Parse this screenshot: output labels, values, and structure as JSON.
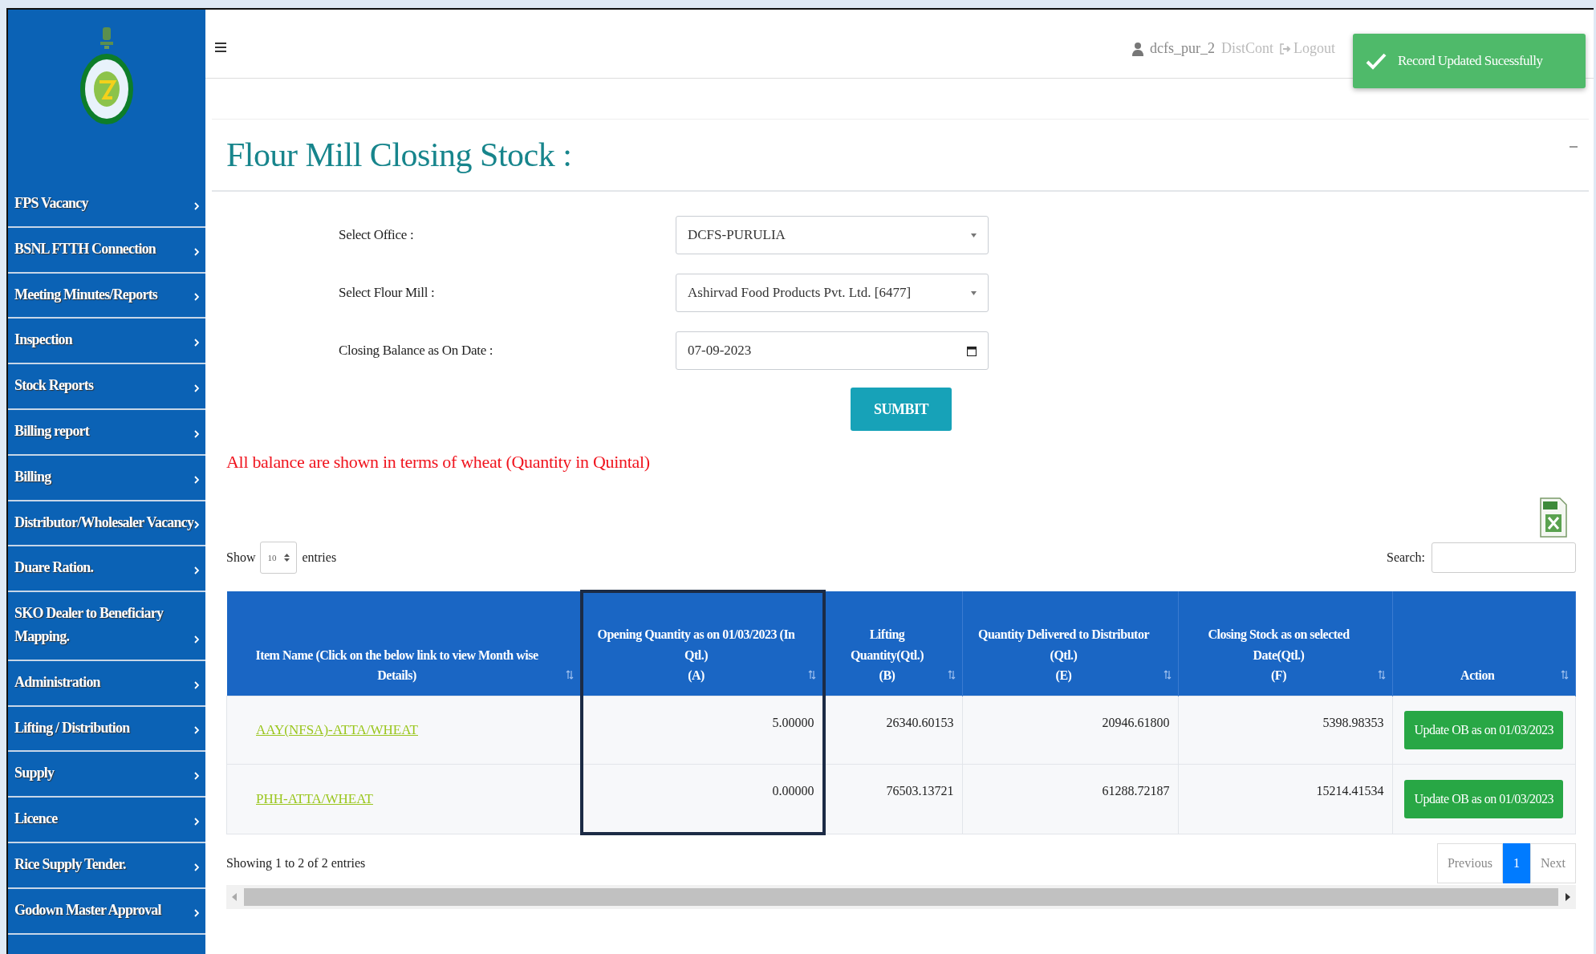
{
  "sidebar": {
    "items": [
      {
        "label": "FPS Vacancy",
        "selected": false
      },
      {
        "label": "BSNL FTTH Connection",
        "selected": false
      },
      {
        "label": "Meeting Minutes/Reports",
        "selected": false
      },
      {
        "label": "Inspection",
        "selected": false
      },
      {
        "label": "Stock Reports",
        "selected": false
      },
      {
        "label": "Billing report",
        "selected": false
      },
      {
        "label": "Billing",
        "selected": false
      },
      {
        "label": "Distributor/Wholesaler Vacancy",
        "selected": false
      },
      {
        "label": "Duare Ration.",
        "selected": false
      },
      {
        "label": "SKO Dealer to Beneficiary Mapping.",
        "selected": false
      },
      {
        "label": "Administration",
        "selected": false
      },
      {
        "label": "Lifting / Distribution",
        "selected": false
      },
      {
        "label": "Supply",
        "selected": false
      },
      {
        "label": "Licence",
        "selected": false
      },
      {
        "label": "Rice Supply Tender.",
        "selected": false
      },
      {
        "label": "Godown Master Approval",
        "selected": false
      }
    ]
  },
  "header": {
    "user": "dcfs_pur_2",
    "role": "DistCont",
    "logout": "Logout"
  },
  "toast": {
    "message": "Record Updated Sucessfully"
  },
  "page_title": "Flour Mill Closing Stock :",
  "form": {
    "fields": [
      {
        "kind": "select",
        "label": "Select Office :",
        "value": "DCFS-PURULIA"
      },
      {
        "kind": "select",
        "label": "Select Flour Mill :",
        "value": "Ashirvad Food Products Pvt. Ltd. [6477]"
      },
      {
        "kind": "date",
        "label": "Closing Balance as On Date :",
        "value": "07-09-2023"
      }
    ],
    "submit": "SUMBIT"
  },
  "notice": "All balance are shown in terms of wheat (Quantity in Quintal)",
  "table_controls": {
    "show_label": "Show",
    "page_size": "10",
    "entries_label": "entries",
    "search_label": "Search:"
  },
  "table": {
    "columns": [
      {
        "lines": [
          "Item Name (Click on the below link to view Month wise Details)"
        ],
        "highlighted": false
      },
      {
        "lines": [
          "Opening Quantity as on 01/03/2023 (In Qtl.)",
          "(A)"
        ],
        "highlighted": true
      },
      {
        "lines": [
          "Lifting Quantity(Qtl.)",
          "(B)"
        ],
        "highlighted": false
      },
      {
        "lines": [
          "Quantity Delivered to Distributor (Qtl.)",
          "(E)"
        ],
        "highlighted": false
      },
      {
        "lines": [
          "Closing Stock as on selected Date(Qtl.)",
          "(F)"
        ],
        "highlighted": false
      },
      {
        "lines": [
          "Action"
        ],
        "highlighted": false
      }
    ],
    "rows": [
      {
        "item": "AAY(NFSA)-ATTA/WHEAT",
        "opening": "5.00000",
        "lifting": "26340.60153",
        "delivered": "20946.61800",
        "closing": "5398.98353",
        "action": "Update OB as on 01/03/2023"
      },
      {
        "item": "PHH-ATTA/WHEAT",
        "opening": "0.00000",
        "lifting": "76503.13721",
        "delivered": "61288.72187",
        "closing": "15214.41534",
        "action": "Update OB as on 01/03/2023"
      }
    ]
  },
  "table_info": "Showing 1 to 2 of 2 entries",
  "pagination": [
    {
      "label": "Previous",
      "selected": false
    },
    {
      "label": "1",
      "selected": true
    },
    {
      "label": "Next",
      "selected": false
    }
  ]
}
